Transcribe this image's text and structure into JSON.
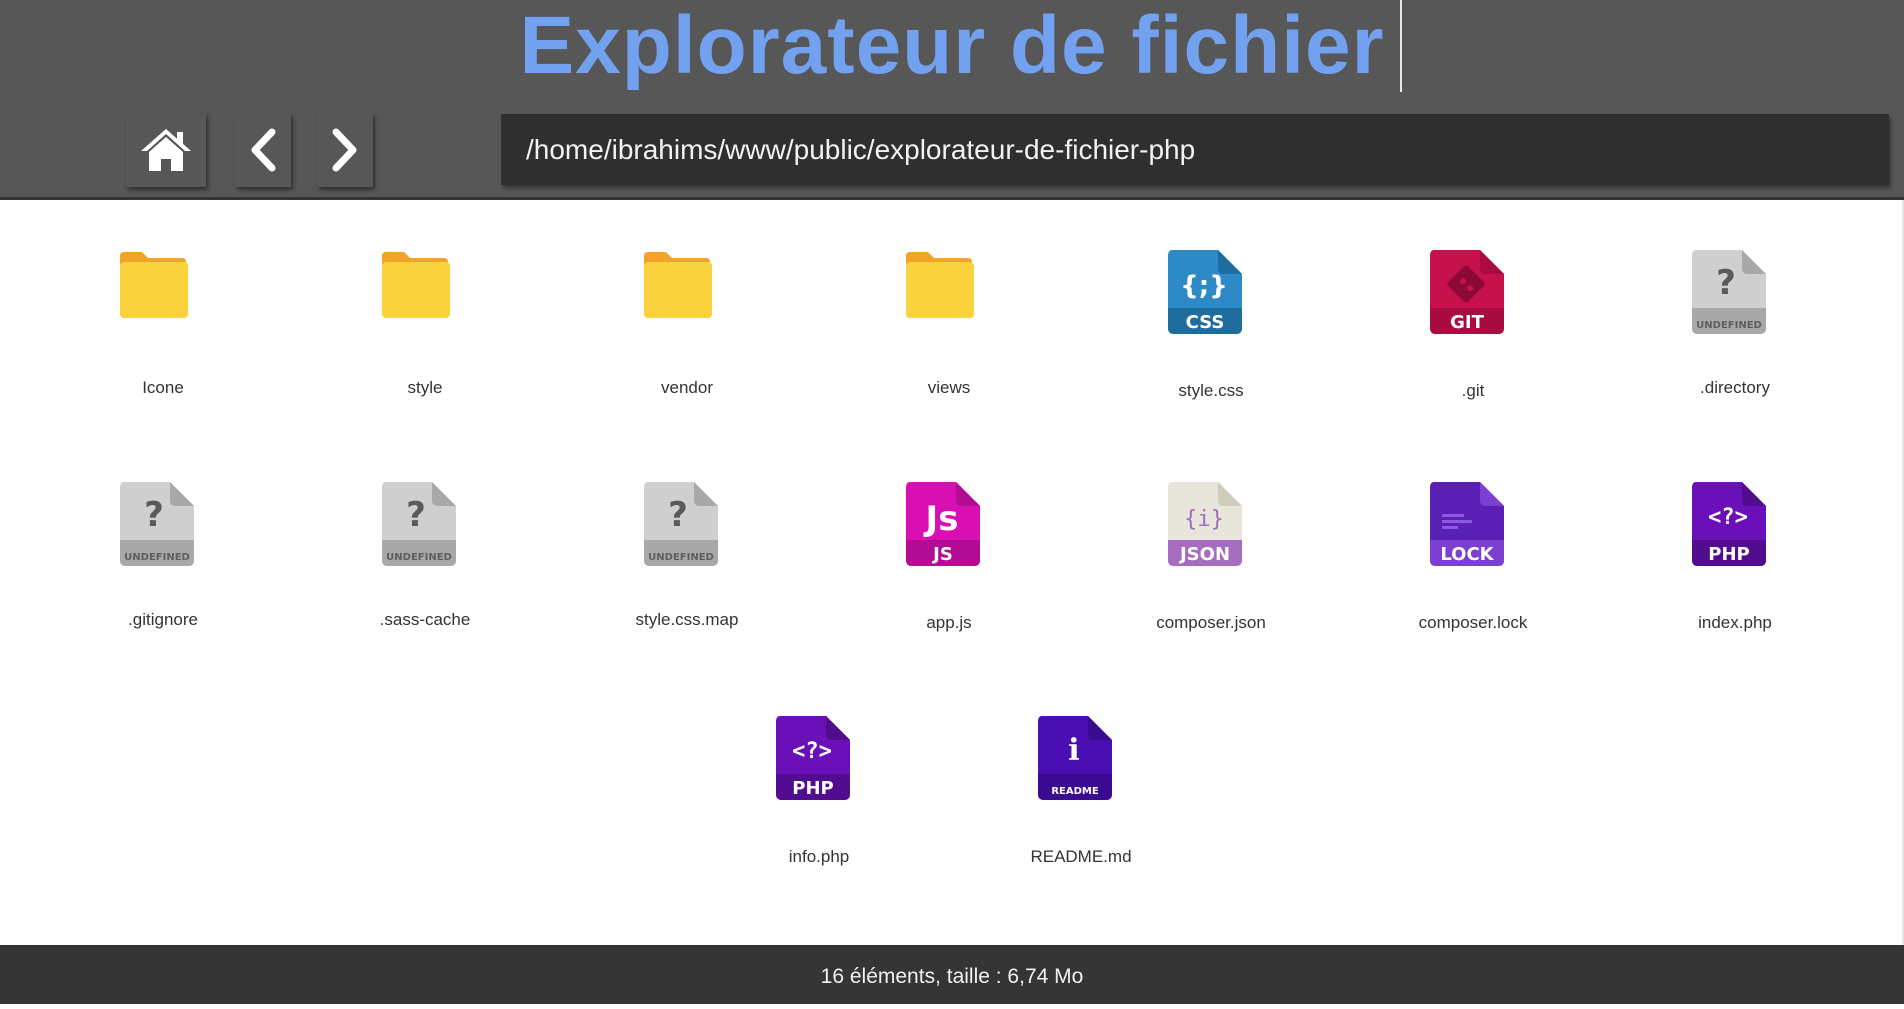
{
  "header": {
    "title": "Explorateur de fichier",
    "home_icon": "home-icon",
    "back_icon": "chevron-left-icon",
    "forward_icon": "chevron-right-icon",
    "path": "/home/ibrahims/www/public/explorateur-de-fichier-php"
  },
  "items": [
    {
      "name": "Icone",
      "type": "folder",
      "icon": "folder-icon"
    },
    {
      "name": "style",
      "type": "folder",
      "icon": "folder-icon"
    },
    {
      "name": "vendor",
      "type": "folder",
      "icon": "folder-icon"
    },
    {
      "name": "views",
      "type": "folder",
      "icon": "folder-icon"
    },
    {
      "name": "style.css",
      "type": "css",
      "icon": "css-file-icon",
      "badge": "CSS"
    },
    {
      "name": ".git",
      "type": "git",
      "icon": "git-file-icon",
      "badge": "GIT"
    },
    {
      "name": ".directory",
      "type": "undefined",
      "icon": "undefined-file-icon",
      "badge": "UNDEFINED"
    },
    {
      "name": ".gitignore",
      "type": "undefined",
      "icon": "undefined-file-icon",
      "badge": "UNDEFINED"
    },
    {
      "name": ".sass-cache",
      "type": "undefined",
      "icon": "undefined-file-icon",
      "badge": "UNDEFINED"
    },
    {
      "name": "style.css.map",
      "type": "undefined",
      "icon": "undefined-file-icon",
      "badge": "UNDEFINED"
    },
    {
      "name": "app.js",
      "type": "js",
      "icon": "js-file-icon",
      "badge": "JS"
    },
    {
      "name": "composer.json",
      "type": "json",
      "icon": "json-file-icon",
      "badge": "JSON"
    },
    {
      "name": "composer.lock",
      "type": "lock",
      "icon": "lock-file-icon",
      "badge": "LOCK"
    },
    {
      "name": "index.php",
      "type": "php",
      "icon": "php-file-icon",
      "badge": "PHP"
    },
    {
      "name": "info.php",
      "type": "php",
      "icon": "php-file-icon",
      "badge": "PHP"
    },
    {
      "name": "README.md",
      "type": "readme",
      "icon": "readme-file-icon",
      "badge": "README"
    }
  ],
  "footer": {
    "status": "16 éléments, taille : 6,74 Mo"
  },
  "colors": {
    "title": "#72a1ef",
    "header_bg": "#575757",
    "path_bg": "#2f2f2f",
    "footer_bg": "#353535",
    "folder": "#f9d23c",
    "css": "#2d8ac7",
    "git": "#c7114d",
    "js": "#d90fb4",
    "json_badge": "#a56cc0",
    "lock": "#5a1fb5",
    "php": "#6a10b8",
    "readme": "#4a0fb3"
  }
}
